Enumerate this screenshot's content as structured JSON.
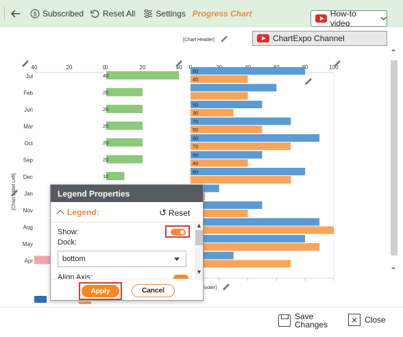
{
  "toolbar": {
    "subscribed_label": "Subscribed",
    "reset_all_label": "Reset All",
    "settings_label": "Settings",
    "title": "Progress Chart",
    "video_label": "How-to video",
    "channel_label": "ChartExpo Channel"
  },
  "chart_placeholders": {
    "header": "[Chart Header]",
    "left_label": "[Chart Label Left]",
    "footer": "Footer]"
  },
  "bottom_bar": {
    "save_line1": "Save",
    "save_line2": "Changes",
    "close_label": "Close"
  },
  "dialog": {
    "title": "Legend Properties",
    "section": "Legend:",
    "reset_label": "Reset",
    "show_label": "Show:",
    "show_on": true,
    "dock_label": "Dock:",
    "dock_value": "bottom",
    "align_label": "Align Axis:",
    "apply_label": "Apply",
    "cancel_label": "Cancel"
  },
  "colors": {
    "blue": "#5b9bd5",
    "orange": "#fba458",
    "green": "#8cc97a",
    "pink": "#f4a3a8",
    "accent": "#f08a3c",
    "highlight": "#d63a3a"
  },
  "chart_data": [
    {
      "type": "bar",
      "orientation": "horizontal",
      "categories": [
        "Jul",
        "Feb",
        "Jun",
        "Mar",
        "Oct",
        "Sep",
        "Dec",
        "Jan",
        "Nov",
        "Aug",
        "May",
        "Apr"
      ],
      "x_ticks_left": [
        40,
        20,
        0
      ],
      "series": [
        {
          "values": [
            null,
            null,
            null,
            null,
            null,
            null,
            null,
            null,
            null,
            null,
            null,
            null
          ]
        }
      ]
    },
    {
      "type": "bar",
      "orientation": "horizontal",
      "categories": [
        "Jul",
        "Feb",
        "Jun",
        "Mar",
        "Oct",
        "Sep",
        "Dec",
        "Jan",
        "Nov",
        "Aug",
        "May",
        "Apr"
      ],
      "x_ticks": [
        0,
        20,
        40
      ],
      "series": [
        {
          "values": [
            40,
            20,
            20,
            20,
            20,
            20,
            10,
            null,
            null,
            null,
            null,
            null
          ]
        }
      ],
      "visible_labels": [
        "40",
        "20",
        "20",
        "20",
        "20",
        "20",
        "10"
      ]
    },
    {
      "type": "bar",
      "orientation": "horizontal",
      "categories": [
        "Jul",
        "Feb",
        "Jun",
        "Mar",
        "Oct",
        "Sep",
        "Dec",
        "Jan",
        "Nov",
        "Aug",
        "May",
        "Apr"
      ],
      "x_ticks": [
        0,
        20,
        40,
        60,
        80,
        100
      ],
      "xlim": [
        0,
        100
      ],
      "series": [
        {
          "values": [
            80,
            60,
            50,
            70,
            90,
            50,
            80,
            20,
            50,
            90,
            80,
            30
          ]
        },
        {
          "values": [
            40,
            40,
            30,
            50,
            70,
            40,
            70,
            10,
            40,
            100,
            90,
            70
          ]
        }
      ],
      "bar_labels": {
        "blue": [
          "80",
          "",
          "50",
          "70",
          "90",
          "50",
          "80",
          "",
          "",
          "",
          "",
          ""
        ],
        "orange": [
          "40",
          "",
          "30",
          "50",
          "70",
          "40",
          "",
          "",
          "",
          "",
          "",
          ""
        ]
      }
    }
  ]
}
